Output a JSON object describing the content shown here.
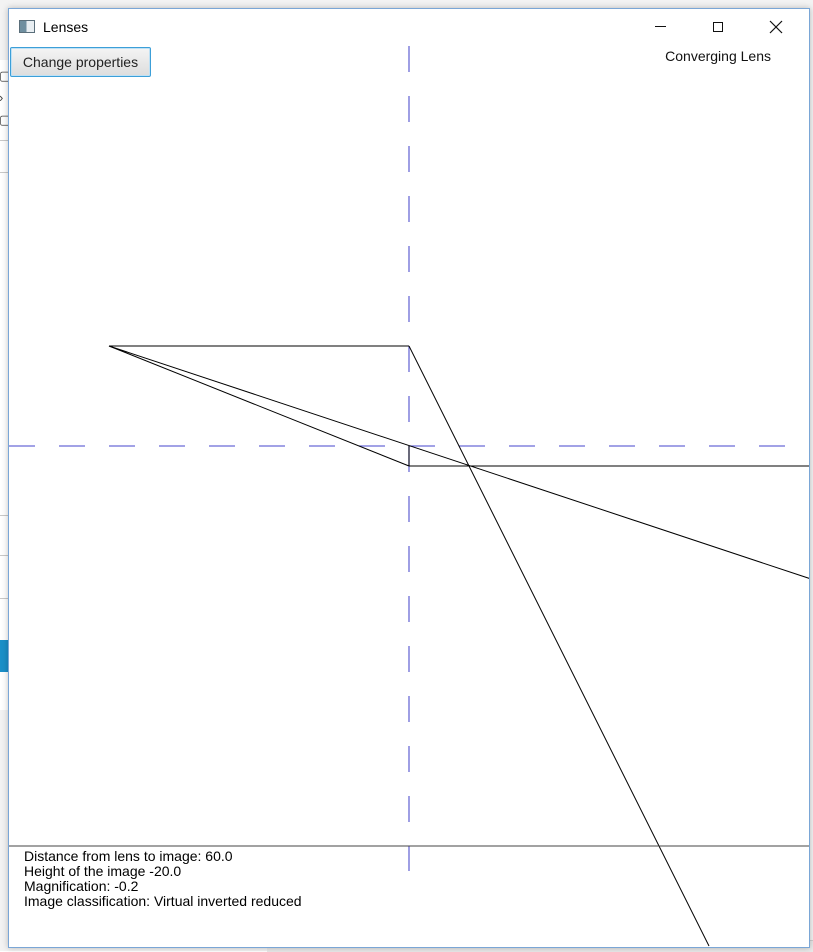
{
  "window": {
    "title": "Lenses",
    "controls": {
      "minimize": "minimize",
      "maximize": "maximize",
      "close": "close"
    }
  },
  "toolbar": {
    "change_properties_label": "Change properties"
  },
  "lens_type": "Converging Lens",
  "results": {
    "distance": "Distance from lens to image: 60.0",
    "height": "Height of the image -20.0",
    "magnification": "Magnification: -0.2",
    "classification": "Image classification: Virtual inverted reduced"
  },
  "colors": {
    "axis": "#6b6bd6",
    "ray": "#000000",
    "button_border": "#3c9fd8",
    "background_accent": "#1b8fc8"
  }
}
